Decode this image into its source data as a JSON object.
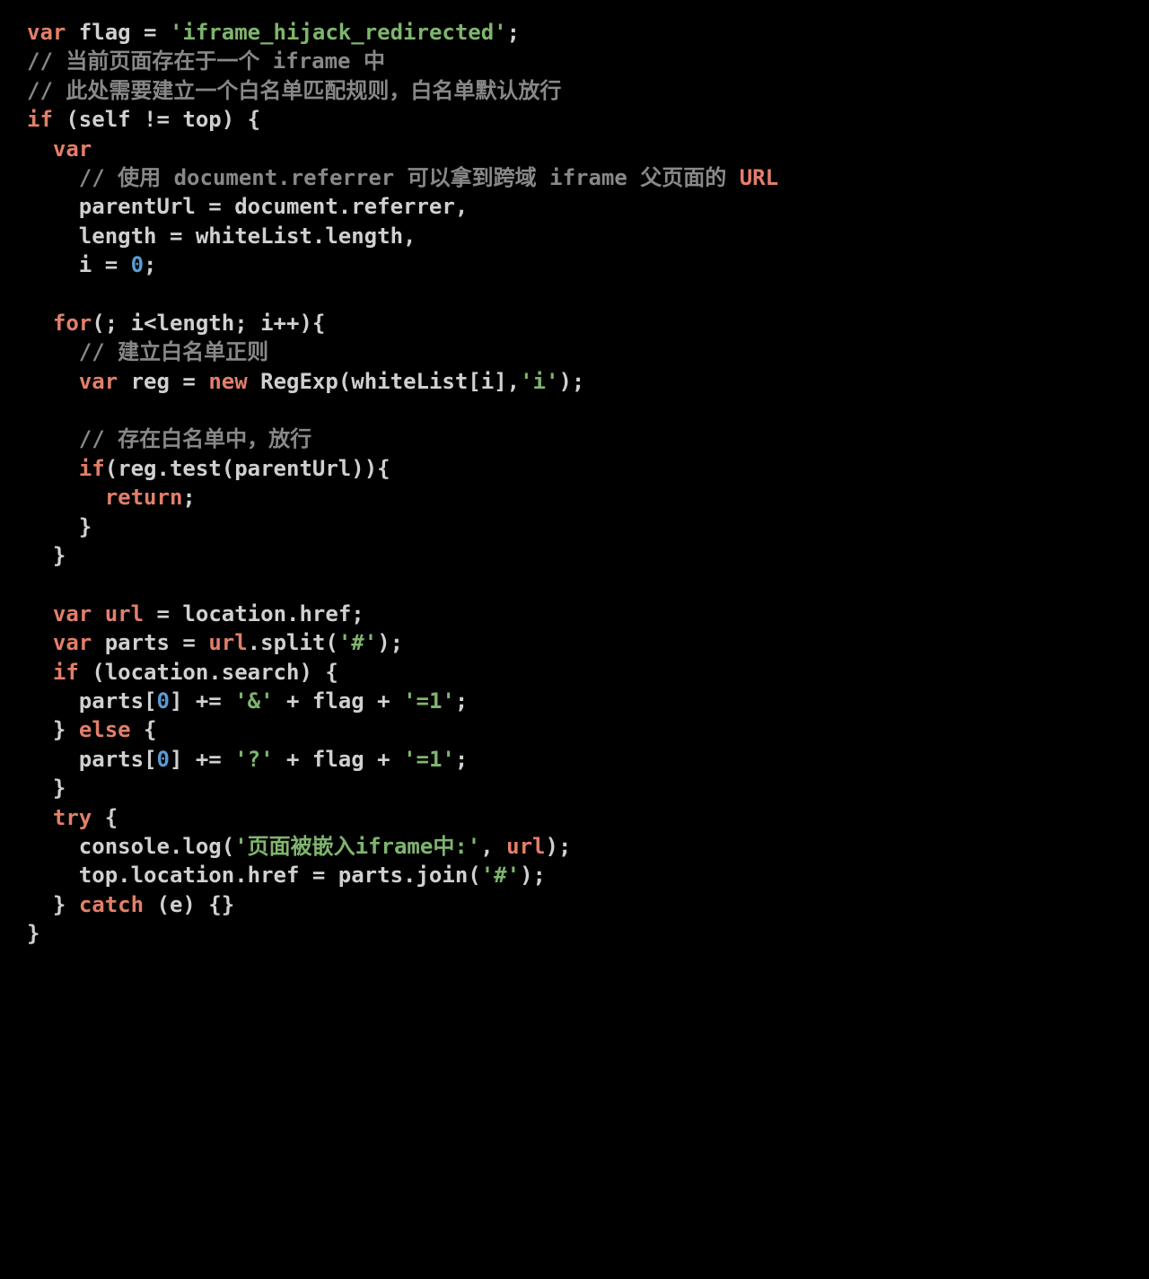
{
  "code": {
    "t01": "var",
    "t02": " flag = ",
    "t03": "'iframe_hijack_redirected'",
    "t04": ";",
    "t05": "// 当前页面存在于一个 iframe 中",
    "t06": "// 此处需要建立一个白名单匹配规则，白名单默认放行",
    "t07": "if",
    "t08": " (self != top) {",
    "t09": "  ",
    "t10": "var",
    "t11": "    ",
    "t12": "// 使用 document.referrer 可以拿到跨域 iframe 父页面的 ",
    "t13": "URL",
    "t14": "    parentUrl = document.referrer,",
    "t15": "    length = whiteList.length,",
    "t16": "    i = ",
    "t17": "0",
    "t18": ";",
    "t19": "  ",
    "t20": "for",
    "t21": "(; i<length; i++){",
    "t22": "    ",
    "t23": "// 建立白名单正则",
    "t24": "    ",
    "t25": "var",
    "t26": " reg = ",
    "t27": "new",
    "t28": " RegExp(whiteList[i],",
    "t29": "'i'",
    "t30": ");",
    "t31": "    ",
    "t32": "// 存在白名单中，放行",
    "t33": "    ",
    "t34": "if",
    "t35": "(reg.test(parentUrl)){",
    "t36": "      ",
    "t37": "return",
    "t38": ";",
    "t39": "    }",
    "t40": "  }",
    "t41": "  ",
    "t42": "var",
    "t43": " ",
    "t44": "url",
    "t45": " = location.href;",
    "t46": "  ",
    "t47": "var",
    "t48": " parts = ",
    "t49": "url",
    "t50": ".split(",
    "t51": "'#'",
    "t52": ");",
    "t53": "  ",
    "t54": "if",
    "t55": " (location.search) {",
    "t56": "    parts[",
    "t57": "0",
    "t58": "] += ",
    "t59": "'&'",
    "t60": " + flag + ",
    "t61": "'=1'",
    "t62": ";",
    "t63": "  } ",
    "t64": "else",
    "t65": " {",
    "t66": "    parts[",
    "t67": "0",
    "t68": "] += ",
    "t69": "'?'",
    "t70": " + flag + ",
    "t71": "'=1'",
    "t72": ";",
    "t73": "  }",
    "t74": "  ",
    "t75": "try",
    "t76": " {",
    "t77": "    console.log(",
    "t78": "'页面被嵌入iframe中:'",
    "t79": ", ",
    "t80": "url",
    "t81": ");",
    "t82": "    top.location.href = parts.join(",
    "t83": "'#'",
    "t84": ");",
    "t85": "  } ",
    "t86": "catch",
    "t87": " (e) {}",
    "t88": "}"
  }
}
